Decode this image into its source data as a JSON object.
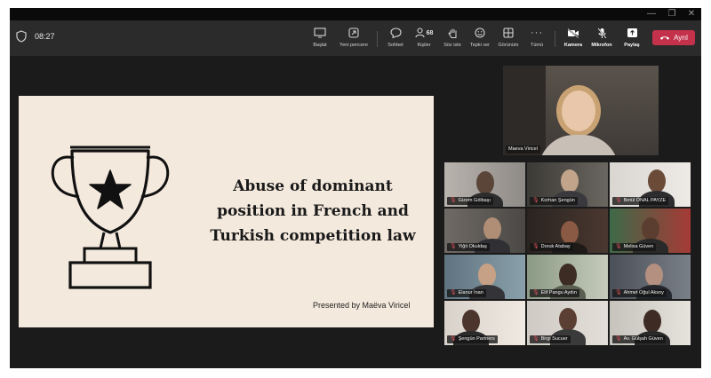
{
  "window": {
    "minimize_icon": "—",
    "restore_icon": "❐",
    "close_icon": "✕"
  },
  "header": {
    "timer": "08:27",
    "participant_count": "68"
  },
  "toolbar": {
    "share": "Başlat",
    "popout": "Yeni pencere",
    "chat": "Sohbet",
    "people": "Kişiler",
    "raise_hand": "Söz iste",
    "react": "Tepki ver",
    "view": "Görünüm",
    "more": "Tümü",
    "camera": "Kamera",
    "mic": "Mikrofon",
    "share_screen": "Paylaş",
    "leave": "Ayrıl"
  },
  "slide": {
    "title_lines": [
      "Abuse of dominant",
      "position in French and",
      "Turkish competition law"
    ],
    "footer": "Presented by Maëva Viricel"
  },
  "spotlight": {
    "name": "Maeva Viricel"
  },
  "participants": [
    "Gizem Gölbaşı",
    "Korhan Şengün",
    "Betül ÖNAL PAYZE",
    "Yiğit Okuldaş",
    "Doruk Atabay",
    "Melisa Güven",
    "Elanur İnan",
    "Elif Pangu Aydın",
    "Ahmet Oğul Aksoy",
    "Şengün Partners",
    "Birgi Sucuer",
    "Av. Gülşah Güven"
  ],
  "colors": {
    "leave_button": "#c4314b",
    "slide_background": "#f4e9dd",
    "toolbar": "#2b2b2b"
  }
}
